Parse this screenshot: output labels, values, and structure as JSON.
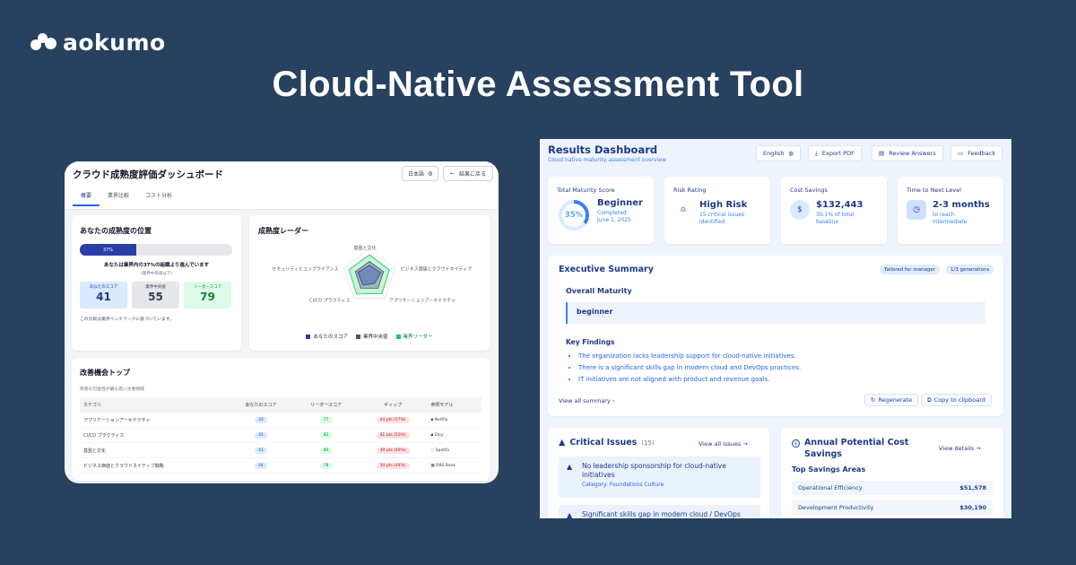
{
  "brand": {
    "name": "aokumo"
  },
  "hero": {
    "title": "Cloud-Native Assessment Tool"
  },
  "jp": {
    "title": "クラウド成熟度評価ダッシュボード",
    "lang_label": "日本語",
    "back_label": "結果に戻る",
    "tabs": [
      "概要",
      "業界比較",
      "コスト分析"
    ],
    "position": {
      "title": "あなたの成熟度の位置",
      "percent": 37,
      "percent_label": "37%",
      "headline": "あなたは業界内の37%の組織より進んでいます",
      "sub": "(業界中央値以下)",
      "scores": [
        {
          "label": "あなたのスコア",
          "value": "41"
        },
        {
          "label": "業界中央値",
          "value": "55"
        },
        {
          "label": "リーダースコア",
          "value": "79"
        }
      ],
      "note": "この比較は業界ベンチマークに基づいています。"
    },
    "radar": {
      "title": "成熟度レーダー",
      "axes": [
        "基盤と文化",
        "ビジネス価値とクラウドネイティブ",
        "アプリケーションアーキテクチャ",
        "CI/CD プラクティス",
        "セキュリティとコンプライアンス"
      ],
      "legend": [
        "あなたのスコア",
        "業界中央値",
        "業界リーダー"
      ],
      "colors": {
        "you": "#2a3ea8",
        "industry": "#4b5563",
        "leader": "#22c55e"
      }
    },
    "opportunities": {
      "title": "改善機会トップ",
      "subtitle": "改善の可能性が最も高い主要領域",
      "columns": [
        "カテゴリ",
        "あなたのスコア",
        "リーダースコア",
        "ギャップ",
        "参照モデル"
      ],
      "rows": [
        {
          "category": "アプリケーションアーキテクチャ",
          "you": "33",
          "leader": "77",
          "gap": "44 pts (57%)",
          "ref": "Netflix"
        },
        {
          "category": "CI/CD プラクティス",
          "you": "41",
          "leader": "82",
          "gap": "41 pts (50%)",
          "ref": "Etsy"
        },
        {
          "category": "基盤と文化",
          "you": "41",
          "leader": "80",
          "gap": "39 pts (49%)",
          "ref": "Spotify"
        },
        {
          "category": "ビジネス価値とクラウドネイティブ戦略",
          "you": "44",
          "leader": "78",
          "gap": "34 pts (44%)",
          "ref": "DBS Bank"
        }
      ]
    }
  },
  "rd": {
    "title": "Results Dashboard",
    "subtitle": "Cloud native maturity assessment overview",
    "buttons": {
      "lang": "English",
      "export": "Export PDF",
      "review": "Review Answers",
      "feedback": "Feedback"
    },
    "kpis": {
      "maturity": {
        "label": "Total Maturity Score",
        "percent": 35,
        "percent_label": "35%",
        "value": "Beginner",
        "desc1": "Completed",
        "desc2": "June 1, 2025"
      },
      "risk": {
        "label": "Risk Rating",
        "value": "High Risk",
        "desc1": "15 critical issues",
        "desc2": "identified"
      },
      "savings": {
        "label": "Cost Savings",
        "value": "$132,443",
        "desc1": "30.1% of total",
        "desc2": "baseline"
      },
      "time": {
        "label": "Time to Next Level",
        "value": "2-3 months",
        "desc1": "to reach",
        "desc2": "intermediate"
      }
    },
    "exec": {
      "title": "Executive Summary",
      "chip1": "Tailored for manager",
      "chip2": "1/3 generations",
      "overall_title": "Overall Maturity",
      "overall_value": "beginner",
      "findings_title": "Key Findings",
      "findings": [
        "The organization lacks leadership support for cloud-native initiatives.",
        "There is a significant skills gap in modern cloud and DevOps practices.",
        "IT initiatives are not aligned with product and revenue goals."
      ],
      "view_all": "View all summary",
      "regenerate": "Regenerate",
      "copy": "Copy to clipboard"
    },
    "issues": {
      "title": "Critical Issues",
      "count": "(15)",
      "link": "View all issues",
      "items": [
        {
          "title": "No leadership sponsorship for cloud-native initiatives",
          "category": "Category: Foundations Culture"
        },
        {
          "title": "Significant skills gap in modern cloud / DevOps",
          "category": ""
        }
      ]
    },
    "savings": {
      "title": "Annual Potential Cost Savings",
      "link": "View details",
      "areas_title": "Top Savings Areas",
      "rows": [
        {
          "name": "Operational Efficiency",
          "amount": "$51,578"
        },
        {
          "name": "Development Productivity",
          "amount": "$30,190"
        }
      ]
    }
  }
}
